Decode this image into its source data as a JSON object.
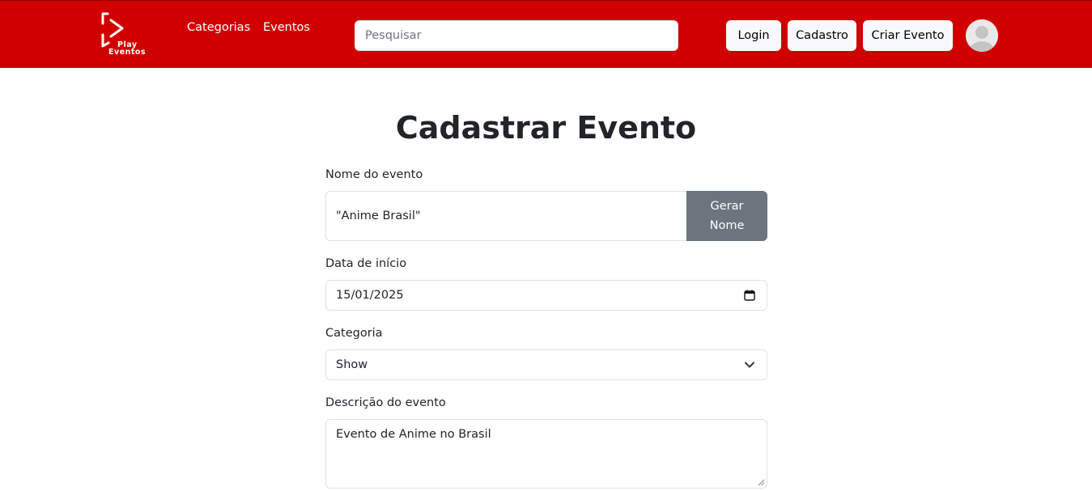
{
  "header": {
    "logo_line1": "Play",
    "logo_line2": "Eventos",
    "nav_links": [
      "Categorias",
      "Eventos"
    ],
    "search_placeholder": "Pesquisar",
    "buttons": {
      "login": "Login",
      "signup": "Cadastro",
      "create_event": "Criar Evento"
    }
  },
  "form": {
    "title": "Cadastrar Evento",
    "name_label": "Nome do evento",
    "name_value": "\"Anime Brasil\"",
    "generate_button": "Gerar Nome",
    "date_label": "Data de início",
    "date_value": "15/01/2025",
    "category_label": "Categoria",
    "category_value": "Show",
    "description_label": "Descrição do evento",
    "description_value": "Evento de Anime no Brasil"
  },
  "icons": {
    "logo": "play-logo-icon",
    "avatar": "user-avatar-icon",
    "calendar": "calendar-icon",
    "dropdown": "chevron-down-icon"
  },
  "colors": {
    "navbar": "#d10000",
    "secondary_button": "#6c757d",
    "light_button": "#f8f9fa"
  }
}
